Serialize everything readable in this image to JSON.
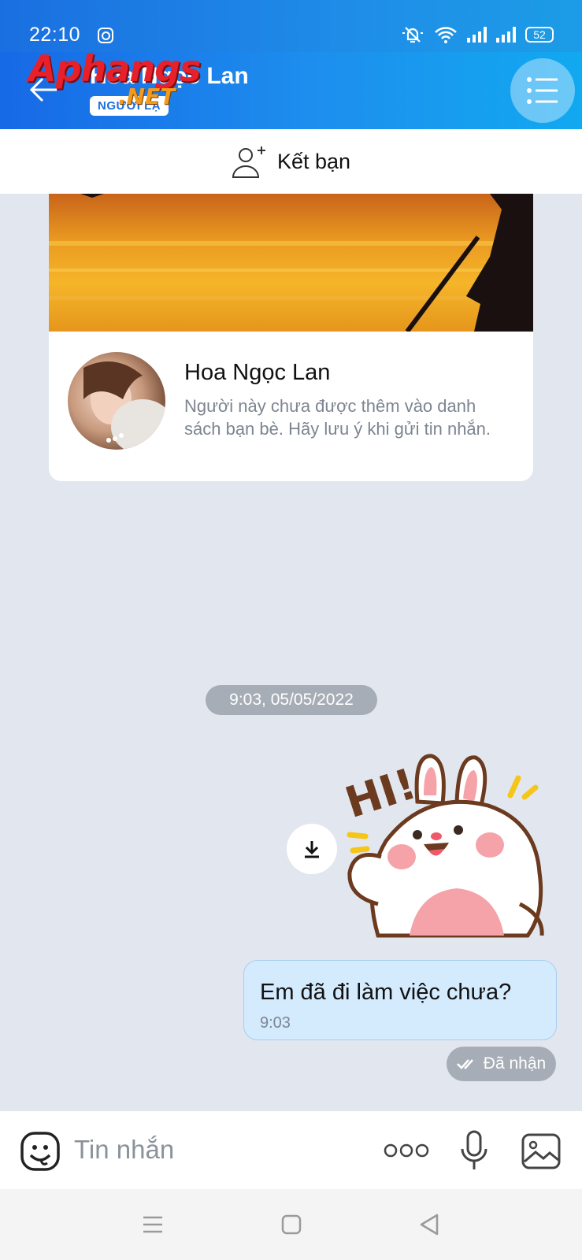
{
  "status_bar": {
    "time": "22:10",
    "battery": "52"
  },
  "header": {
    "title": "Hoa Ngọc Lan",
    "stranger_badge": "NGƯỜI LẠ",
    "watermark_main": "Aphangs",
    "watermark_sub": ".NET"
  },
  "add_friend": {
    "label": "Kết bạn"
  },
  "profile_card": {
    "name": "Hoa Ngọc Lan",
    "description": "Người này chưa được thêm vào danh sách bạn bè. Hãy lưu ý khi gửi tin nhắn."
  },
  "chat": {
    "date_separator": "9:03, 05/05/2022",
    "messages": [
      {
        "type": "sticker",
        "icon": "bunny-hi-sticker"
      },
      {
        "type": "text",
        "text": "Em đã đi làm việc chưa?",
        "time": "9:03"
      }
    ],
    "status": "Đã nhận"
  },
  "composer": {
    "placeholder": "Tin nhắn"
  },
  "colors": {
    "accent": "#1a6fe0",
    "bubble": "#d4eafd",
    "background": "#e2e7ef"
  }
}
